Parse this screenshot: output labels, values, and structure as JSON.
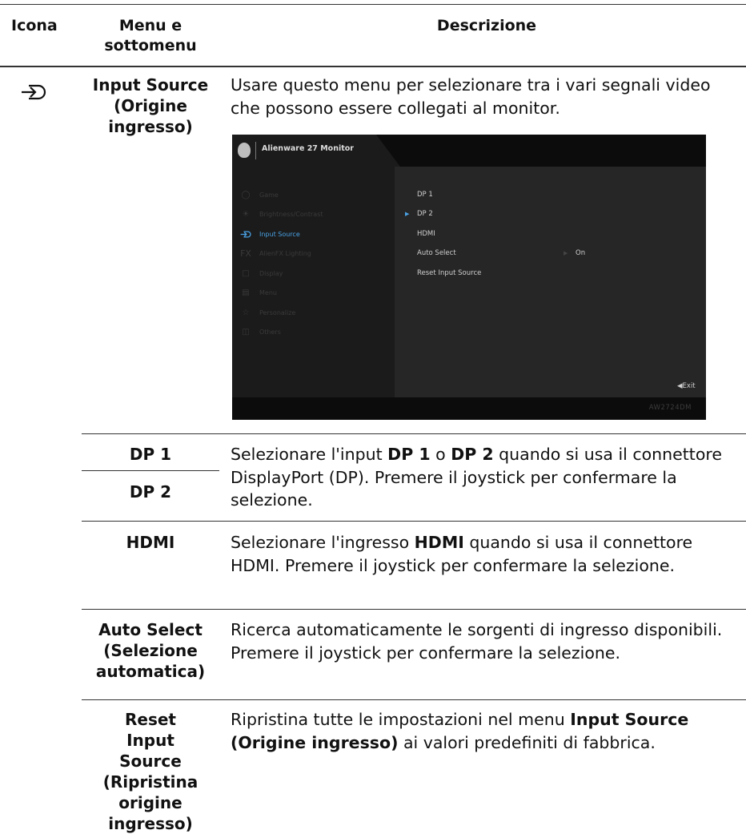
{
  "header": {
    "col_icon": "Icona",
    "col_menu": "Menu e sottomenu",
    "col_desc": "Descrizione"
  },
  "rows": {
    "input_source": {
      "name": "Input Source (Origine ingresso)",
      "desc": "Usare questo menu per selezionare tra i vari segnali video che possono essere collegati al monitor.",
      "icon": "input-source-icon"
    },
    "dp1": {
      "name": "DP 1"
    },
    "dp2": {
      "name": "DP 2"
    },
    "dp_desc": {
      "t1": "Selezionare l'input ",
      "b1": "DP 1",
      "t2": " o ",
      "b2": "DP 2",
      "t3": " quando si usa il connettore DisplayPort (DP). Premere il joystick per confermare la selezione."
    },
    "hdmi": {
      "name": "HDMI",
      "t1": "Selezionare l'ingresso ",
      "b1": "HDMI",
      "t2": " quando si usa il connettore HDMI. Premere il joystick per confermare la selezione."
    },
    "auto_select": {
      "name": "Auto Select (Selezione automatica)",
      "desc": "Ricerca automaticamente le sorgenti di ingresso disponibili. Premere il joystick per confermare la selezione."
    },
    "reset": {
      "name": "Reset Input Source (Ripristina origine ingresso)",
      "t1": "Ripristina tutte le impostazioni nel menu ",
      "b1": "Input Source (Origine ingresso)",
      "t2": " ai valori predefiniti di fabbrica."
    }
  },
  "osd": {
    "title": "Alienware 27 Monitor",
    "nav": [
      {
        "label": "Game",
        "icon": "gamepad-icon"
      },
      {
        "label": "Brightness/Contrast",
        "icon": "brightness-icon"
      },
      {
        "label": "Input Source",
        "icon": "input-source-icon"
      },
      {
        "label": "AlienFX Lighting",
        "icon": "fx-icon"
      },
      {
        "label": "Display",
        "icon": "display-icon"
      },
      {
        "label": "Menu",
        "icon": "menu-icon"
      },
      {
        "label": "Personalize",
        "icon": "star-icon"
      },
      {
        "label": "Others",
        "icon": "info-icon"
      }
    ],
    "active_nav": "Input Source",
    "submenu": [
      "DP 1",
      "DP 2",
      "HDMI",
      "Auto Select",
      "Reset Input Source"
    ],
    "selected_submenu": "DP 2",
    "auto_select_value": "On",
    "exit_label": "Exit",
    "model": "AW2724DM",
    "colors": {
      "accent": "#4aa3e6",
      "panel": "#1b1b1b"
    }
  }
}
